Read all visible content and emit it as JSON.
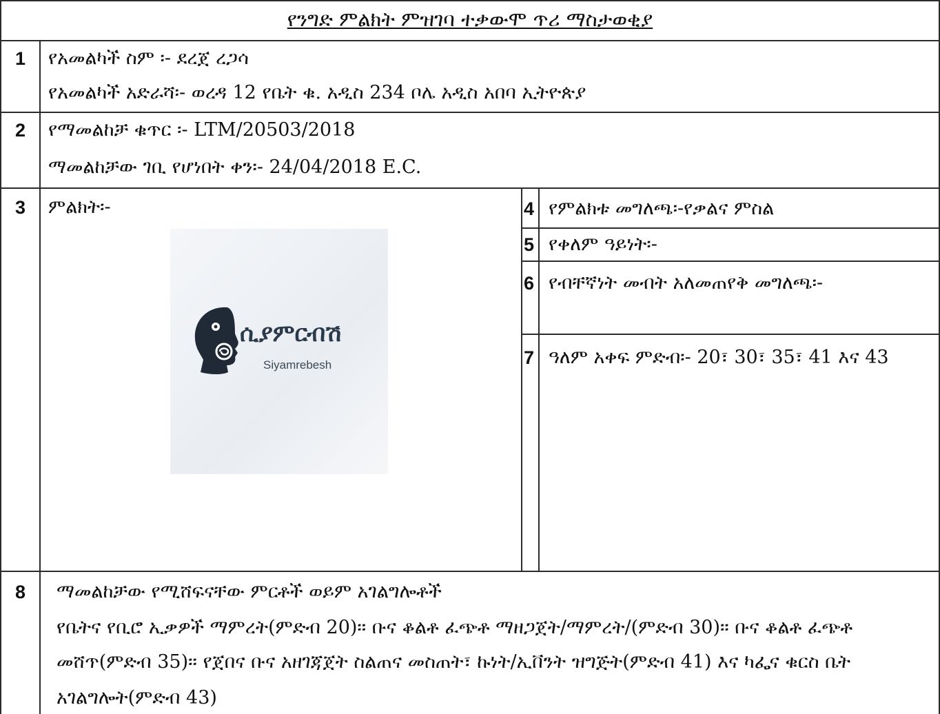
{
  "title": "የንግድ ምልክት ምዝገባ ተቃውሞ ጥሪ ማስታወቂያ",
  "rows": {
    "r1": {
      "num": "1",
      "line1": "የአመልካች ስም ፡- ደረጀ ረጋሳ",
      "line2": "የአመልካች አድራሻ፡- ወረዳ 12 የቤት ቁ. አዲስ 234 ቦሌ አዲስ አበባ ኢትዮጵያ"
    },
    "r2": {
      "num": "2",
      "line1": "የማመልከቻ ቁጥር ፡- LTM/20503/2018",
      "line2": "ማመልከቻው ገቢ የሆነበት ቀን፡- 24/04/2018 E.C."
    },
    "r3": {
      "num": "3",
      "label": "ምልክት፡-"
    },
    "r4": {
      "num": "4",
      "label": "የምልክቱ መግለጫ፡-የቃልና ምስል"
    },
    "r5": {
      "num": "5",
      "label": "የቀለም ዓይነት፡-"
    },
    "r6": {
      "num": "6",
      "label": "የብቸኛነት መብት አለመጠየቅ መግለጫ፡-"
    },
    "r7": {
      "num": "7",
      "label": "ዓለም አቀፍ ምድብ፡- 20፣ 30፣ 35፣ 41 እና 43"
    },
    "r8": {
      "num": "8",
      "heading": "ማመልከቻው የሚሸፍናቸው ምርቶች ወይም አገልግሎቶች",
      "body1": "የቤትና የቢሮ ኢቃዎች ማምረት(ምድብ 20)፡፡ ቡና ቆልቶ ፈጭቶ ማዘጋጀት/ማምረት/(ምድብ 30)፡፡ ቡና ቆልቶ ፈጭቶ",
      "body2": "መሸጥ(ምድብ 35)፡፡ የጀበና ቡና አዘገጃጀት ስልጠና መስጠት፣ ኩነት/ኢቨንት ዝግጅት(ምድብ 41) እና ካፌና ቁርስ ቤት",
      "body3": "አገልግሎት(ምድብ 43)"
    }
  },
  "logo": {
    "name": "ሲያምርብሽ",
    "latin": "Siyamrebesh"
  },
  "colors": {
    "border": "#2b2b2b",
    "logo_dark": "#1f2a36"
  }
}
